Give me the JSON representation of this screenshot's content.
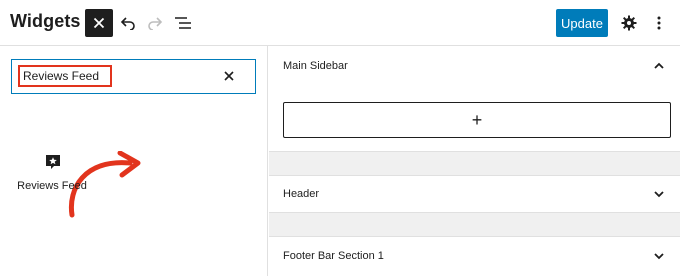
{
  "header": {
    "title": "Widgets",
    "update_label": "Update",
    "icons": [
      "close-icon",
      "undo-icon",
      "redo-icon",
      "list-view-icon",
      "gear-icon",
      "more-vertical-icon"
    ]
  },
  "inserter": {
    "search_value": "Reviews Feed",
    "result": {
      "label": "Reviews Feed",
      "icon": "review-star-icon"
    }
  },
  "areas": [
    {
      "title": "Main Sidebar",
      "expanded": true,
      "add_block_label": "+"
    },
    {
      "title": "Header",
      "expanded": false
    },
    {
      "title": "Footer Bar Section 1",
      "expanded": false
    }
  ],
  "colors": {
    "accent": "#007cba",
    "highlight": "#e2341d",
    "dark": "#1e1e1e"
  }
}
